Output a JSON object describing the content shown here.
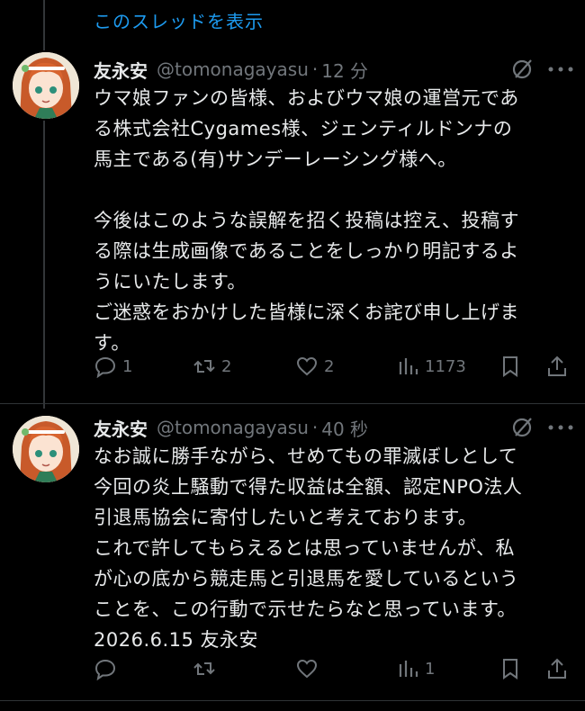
{
  "thread": {
    "show_thread_label": "このスレッドを表示"
  },
  "tweets": [
    {
      "author_name": "友永安",
      "handle": "@tomonagayasu",
      "separator": "·",
      "time": "12 分",
      "lines": [
        "ウマ娘ファンの皆様、およびウマ娘の運営元であ",
        "る株式会社Cygames様、ジェンティルドンナの",
        "馬主である(有)サンデーレーシング様へ。",
        "",
        "今後はこのような誤解を招く投稿は控え、投稿す",
        "る際は生成画像であることをしっかり明記するよ",
        "うにいたします。",
        "ご迷惑をおかけした皆様に深くお詫び申し上げま",
        "す。"
      ],
      "replies": "1",
      "reposts": "2",
      "likes": "2",
      "views": "1173"
    },
    {
      "author_name": "友永安",
      "handle": "@tomonagayasu",
      "separator": "·",
      "time": "40 秒",
      "lines": [
        "なお誠に勝手ながら、せめてもの罪滅ぼしとして",
        "今回の炎上騒動で得た収益は全額、認定NPO法人",
        "引退馬協会に寄付したいと考えております。",
        "これで許してもらえるとは思っていませんが、私",
        "が心の底から競走馬と引退馬を愛しているという",
        "ことを、この行動で示せたらなと思っています。",
        "2026.6.15 友永安"
      ],
      "replies": "",
      "reposts": "",
      "likes": "",
      "views": "1"
    }
  ],
  "colors": {
    "accent": "#1d9bf0",
    "muted": "#71767b",
    "text": "#e7e9ea",
    "background": "#000000"
  }
}
